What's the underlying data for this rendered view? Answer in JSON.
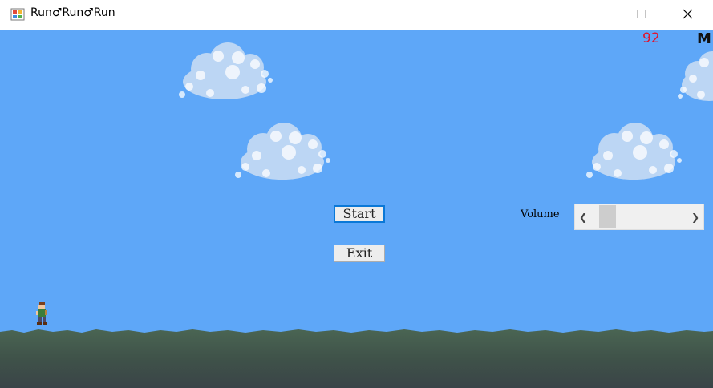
{
  "window": {
    "title": "Run♂Run♂Run",
    "icon": "app-icon"
  },
  "game": {
    "score": "92",
    "score_unit": "M",
    "sky_color": "#5ea7f8",
    "score_color": "#e0142e"
  },
  "menu": {
    "start_label": "Start",
    "exit_label": "Exit"
  },
  "volume": {
    "label": "Volume",
    "level": 0.1
  }
}
